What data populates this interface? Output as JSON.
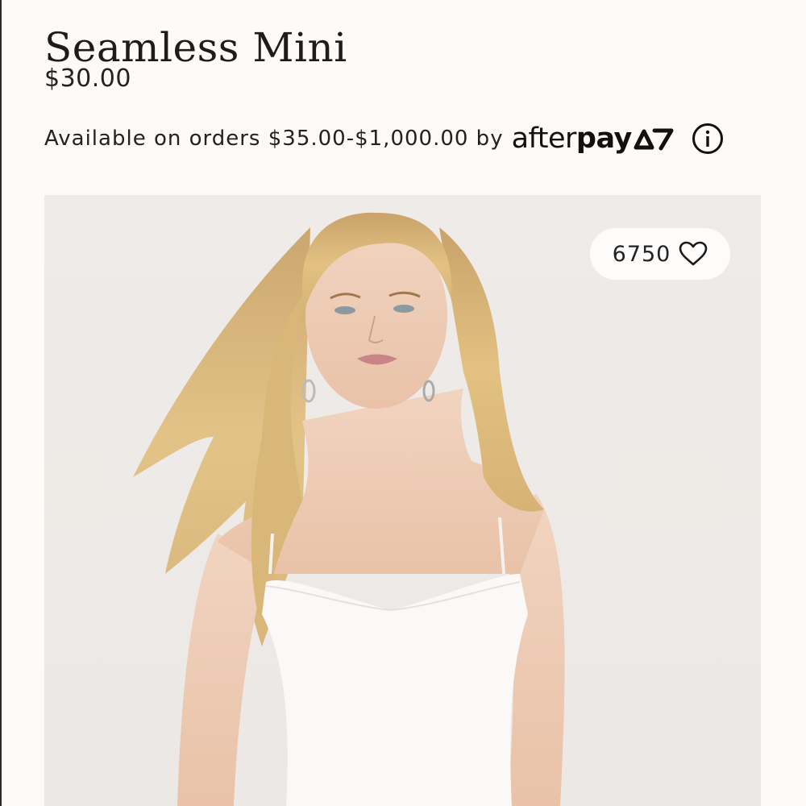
{
  "product": {
    "title": "Seamless Mini",
    "price": "$30.00"
  },
  "afterpay": {
    "text": "Available on orders $35.00-$1,000.00 by",
    "logo_light": "after",
    "logo_bold": "pay",
    "info_icon": "info-circle-icon"
  },
  "gallery": {
    "like_count": "6750",
    "like_icon": "heart-outline-icon"
  },
  "colors": {
    "background": "#fdfaf7",
    "photo_background": "#f0ece9",
    "text": "#1a1a1a"
  }
}
